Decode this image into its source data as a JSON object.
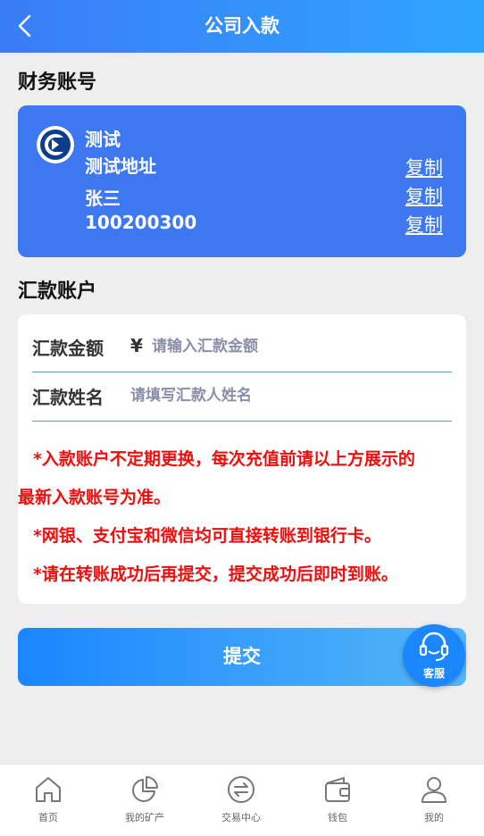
{
  "header": {
    "title": "公司入款",
    "back_icon": "chevron-left-icon"
  },
  "finance": {
    "title": "财务账号",
    "bank_logo_icon": "bank-logo-icon",
    "bank_name": "测试",
    "address": "测试地址",
    "holder": "张三",
    "account_no": "100200300",
    "copy_label": "复制"
  },
  "remit": {
    "title": "汇款账户",
    "amount_label": "汇款金额",
    "currency_symbol": "¥",
    "amount_placeholder": "请输入汇款金额",
    "amount_value": "",
    "name_label": "汇款姓名",
    "name_placeholder": "请填写汇款人姓名",
    "name_value": ""
  },
  "notices": {
    "line1a": "*入款账户不定期更换，每次充值前请以上方展示的",
    "line1b": "最新入款账号为准。",
    "line2": "*网银、支付宝和微信均可直接转账到银行卡。",
    "line3": "*请在转账成功后再提交，提交成功后即时到账。",
    "color": "#f20d0d"
  },
  "submit_label": "提交",
  "customer_service": {
    "label": "客服",
    "icon": "headset-icon"
  },
  "tabbar": [
    {
      "label": "首页",
      "icon": "home-icon"
    },
    {
      "label": "我的矿产",
      "icon": "pie-chart-icon"
    },
    {
      "label": "交易中心",
      "icon": "exchange-icon"
    },
    {
      "label": "钱包",
      "icon": "wallet-icon"
    },
    {
      "label": "我的",
      "icon": "user-icon"
    }
  ],
  "colors": {
    "accent": "#3d78f0",
    "header_start": "#3a7cf6",
    "header_end": "#2fa5ff"
  }
}
